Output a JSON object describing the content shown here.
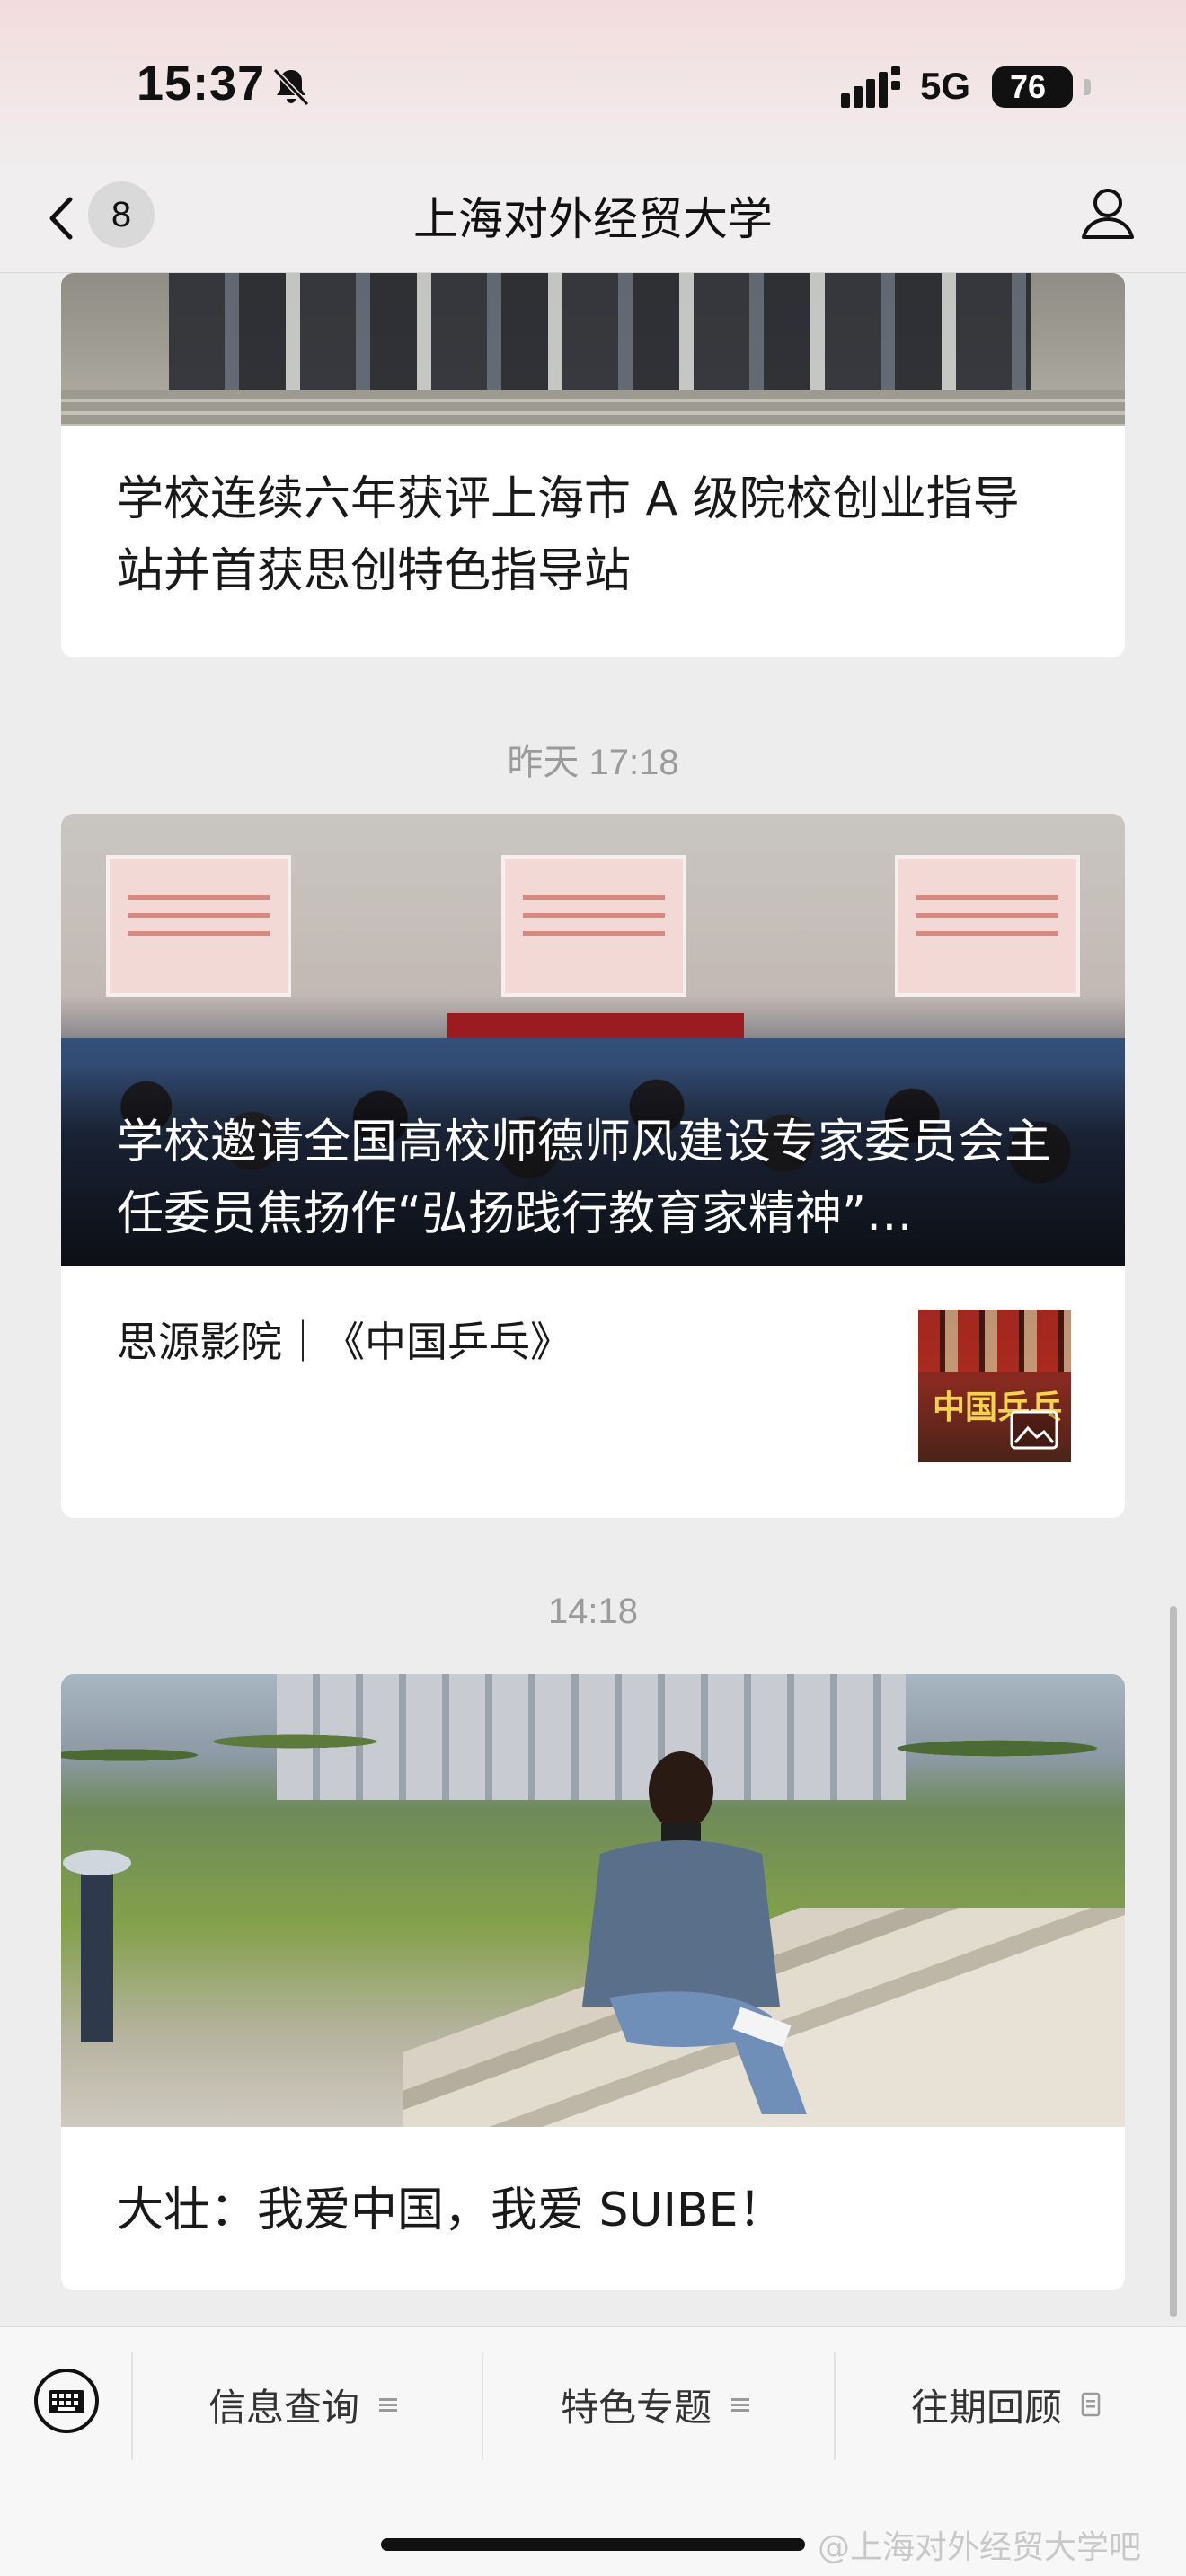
{
  "status_bar": {
    "time": "15:37",
    "network": "5G",
    "battery": "76"
  },
  "nav": {
    "unread_count": "8",
    "title": "上海对外经贸大学"
  },
  "feed": [
    {
      "headline_line1": "学校连续六年获评上海市 A 级院校创业指导",
      "headline_line2": "站并首获思创特色指导站"
    },
    {
      "timestamp": "昨天 17:18",
      "headline": "学校邀请全国高校师德师风建设专家委员会主任委员焦扬作“弘扬践行教育家精神”…",
      "sub_article": "思源影院｜《中国乒乓》",
      "sub_thumb_text": "中国乒乓"
    },
    {
      "timestamp": "14:18",
      "headline": "大壮：我爱中国，我爱 SUIBE！"
    }
  ],
  "bottom_menu": {
    "items": [
      {
        "label": "信息查询"
      },
      {
        "label": "特色专题"
      },
      {
        "label": "往期回顾"
      }
    ]
  },
  "watermark": "@上海对外经贸大学吧",
  "colors": {
    "background": "#ededed",
    "timestamp": "#9b9b9b",
    "card": "#ffffff"
  }
}
